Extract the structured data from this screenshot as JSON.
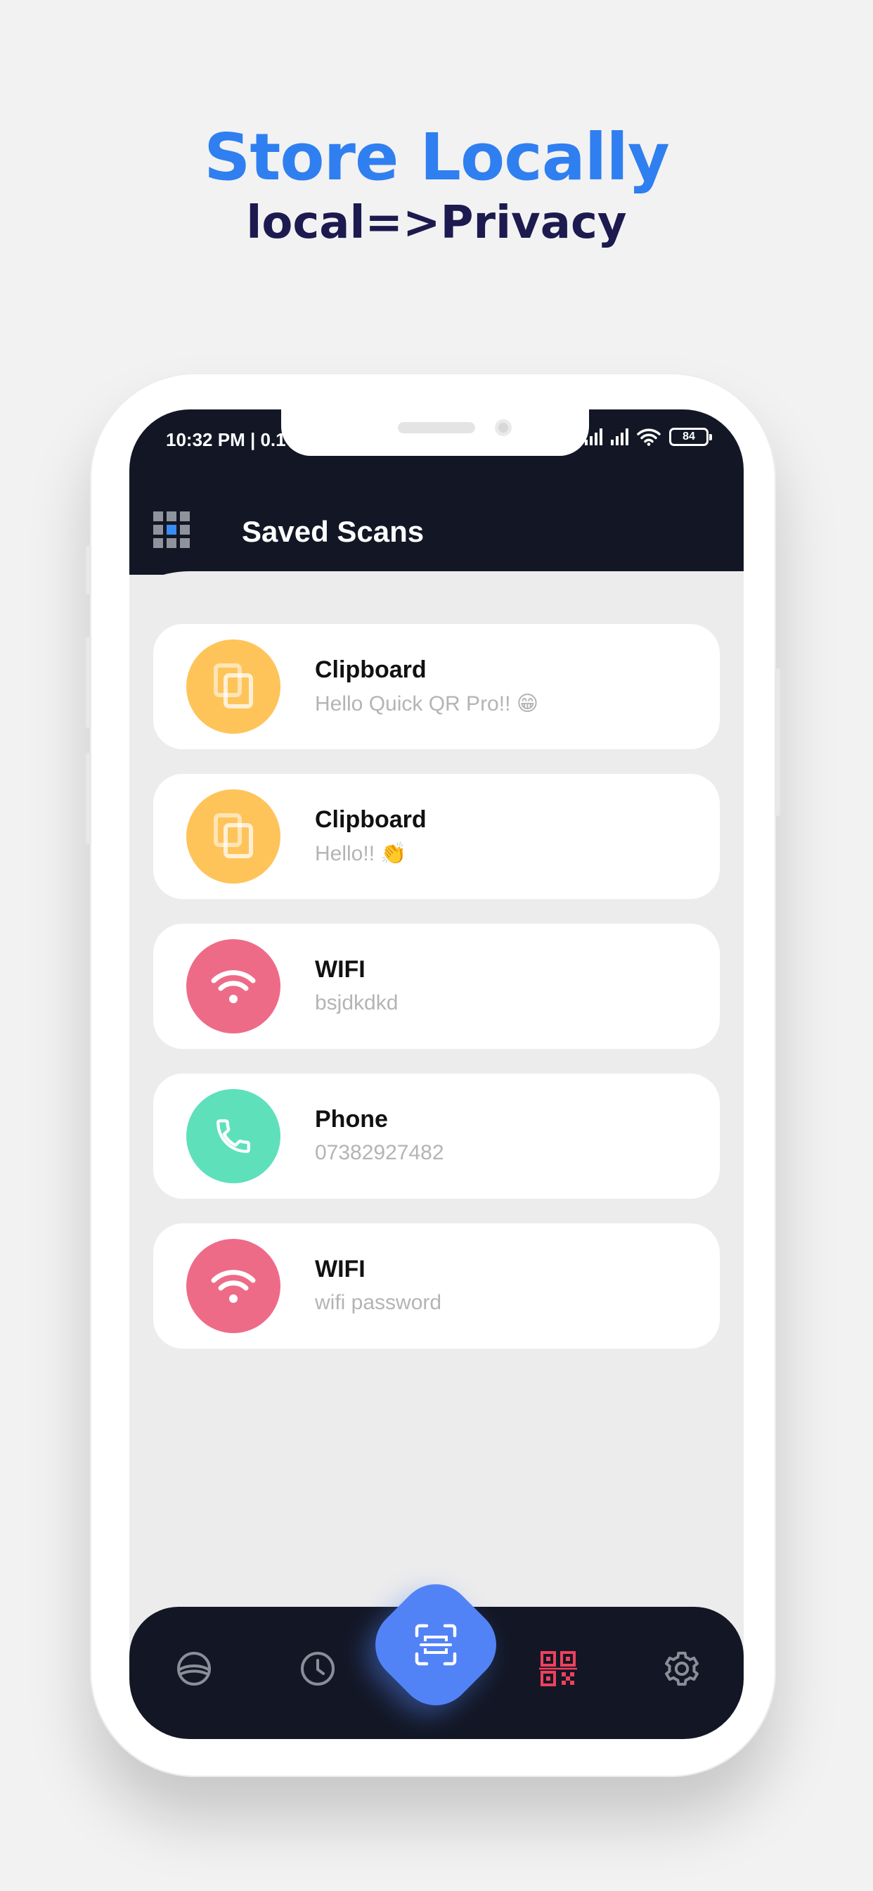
{
  "headline": {
    "title": "Store Locally",
    "subtitle": "local=>Privacy"
  },
  "status_bar": {
    "time": "10:32 PM | 0.1",
    "battery": "84"
  },
  "app_bar": {
    "menu_icon": "grid-menu-icon",
    "title": "Saved Scans"
  },
  "colors": {
    "headline": "#2f7ff0",
    "subheadline": "#1c1a4f",
    "header_bg": "#131725",
    "clipboard": "#fec45a",
    "wifi": "#ee6b87",
    "phone": "#5ee0bb",
    "fab": "#5283f6",
    "active_nav": "#f0405d"
  },
  "scans": [
    {
      "type": "clipboard",
      "icon": "copy-icon",
      "title": "Clipboard",
      "subtitle": "Hello Quick QR Pro!! 😁"
    },
    {
      "type": "clipboard",
      "icon": "copy-icon",
      "title": "Clipboard",
      "subtitle": "Hello!! 👏"
    },
    {
      "type": "wifi",
      "icon": "wifi-icon",
      "title": "WIFI",
      "subtitle": "bsjdkdkd"
    },
    {
      "type": "phone",
      "icon": "phone-icon",
      "title": "Phone",
      "subtitle": "07382927482"
    },
    {
      "type": "wifi",
      "icon": "wifi-icon",
      "title": "WIFI",
      "subtitle": "wifi password"
    }
  ],
  "bottom_nav": {
    "items": [
      {
        "icon": "explore-icon",
        "active": false
      },
      {
        "icon": "history-icon",
        "active": false
      },
      {
        "icon": "scan-icon",
        "active": false,
        "center": true
      },
      {
        "icon": "qr-code-icon",
        "active": true
      },
      {
        "icon": "settings-icon",
        "active": false
      }
    ]
  }
}
